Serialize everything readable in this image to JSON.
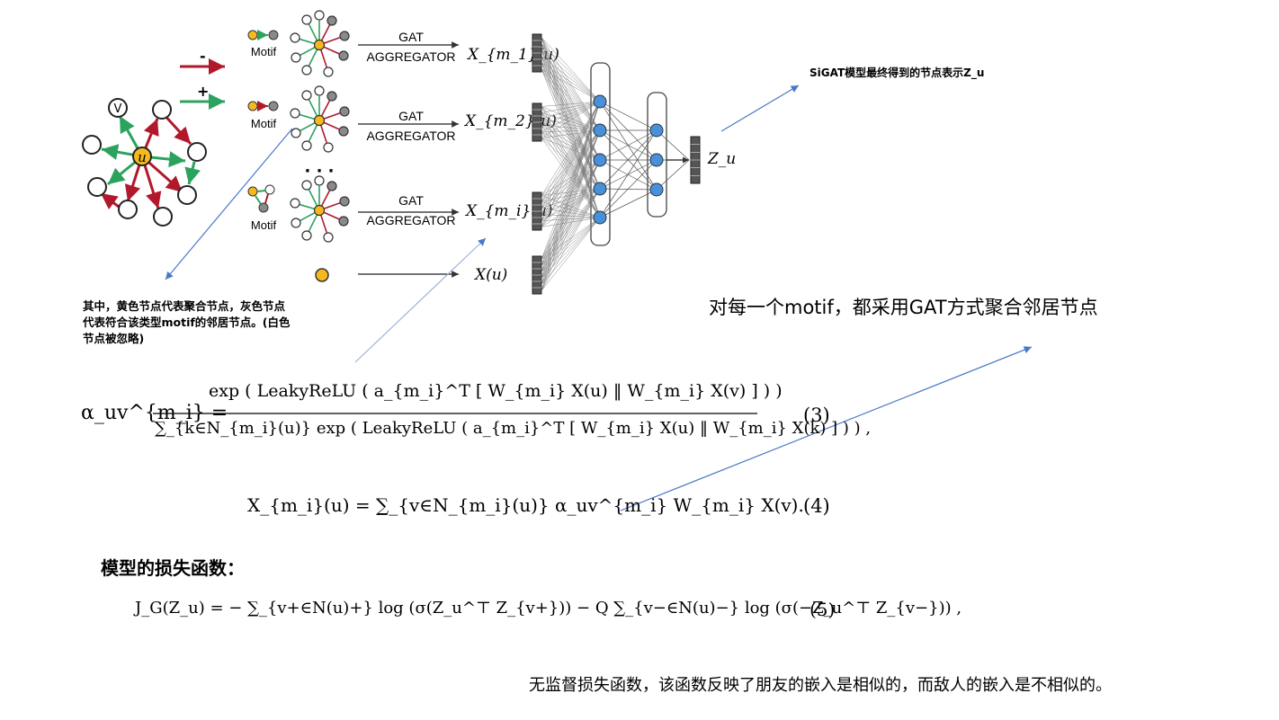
{
  "diagram": {
    "legend": {
      "minus_sign": "-",
      "plus_sign": "+"
    },
    "center_node_label": "u",
    "neighbor_label": "V",
    "motif_labels": [
      "Motif",
      "Motif",
      "Motif"
    ],
    "ellipsis": "· · ·",
    "aggregator_lines": [
      "GAT",
      "AGGREGATOR"
    ],
    "outputs": {
      "xm1": "X_{m_1}(u)",
      "xm2": "X_{m_2}(u)",
      "xmi": "X_{m_i}(u)",
      "xu": "X(u)",
      "zu": "Z_u"
    }
  },
  "annotations": {
    "sigat_note": "SiGAT模型最终得到的节点表示Z_u",
    "node_note_lines": [
      "其中，黄色节点代表聚合节点，灰色节点",
      "代表符合该类型motif的邻居节点。(白色",
      "节点被忽略)"
    ],
    "motif_note": "对每一个motif，都采用GAT方式聚合邻居节点",
    "loss_heading": "模型的损失函数：",
    "loss_note": "无监督损失函数，该函数反映了朋友的嵌入是相似的，而敌人的嵌入是不相似的。"
  },
  "equations": {
    "eq3_lhs": "α_uv^{m_i} =",
    "eq3_num": "exp ( LeakyReLU ( a_{m_i}^T [ W_{m_i} X(u) ‖ W_{m_i} X(v) ] ) )",
    "eq3_den": "∑_{k∈N_{m_i}(u)} exp ( LeakyReLU ( a_{m_i}^T [ W_{m_i} X(u) ‖ W_{m_i} X(k) ] ) ) ,",
    "eq3_no": "(3)",
    "eq4": "X_{m_i}(u) = ∑_{v∈N_{m_i}(u)} α_uv^{m_i} W_{m_i} X(v).",
    "eq4_no": "(4)",
    "eq5": "J_G(Z_u) = − ∑_{v+∈N(u)+} log (σ(Z_u^⊤ Z_{v+})) − Q ∑_{v−∈N(u)−} log (σ(−Z_u^⊤ Z_{v−})) ,",
    "eq5_no": "(5)"
  },
  "colors": {
    "positive_edge": "#2ca25f",
    "negative_edge": "#b2182b",
    "yellow_node": "#f6b91d",
    "gray_node": "#8a8a8a",
    "blue_neuron": "#4a90d9",
    "annotation_arrow": "#4a78c8"
  }
}
